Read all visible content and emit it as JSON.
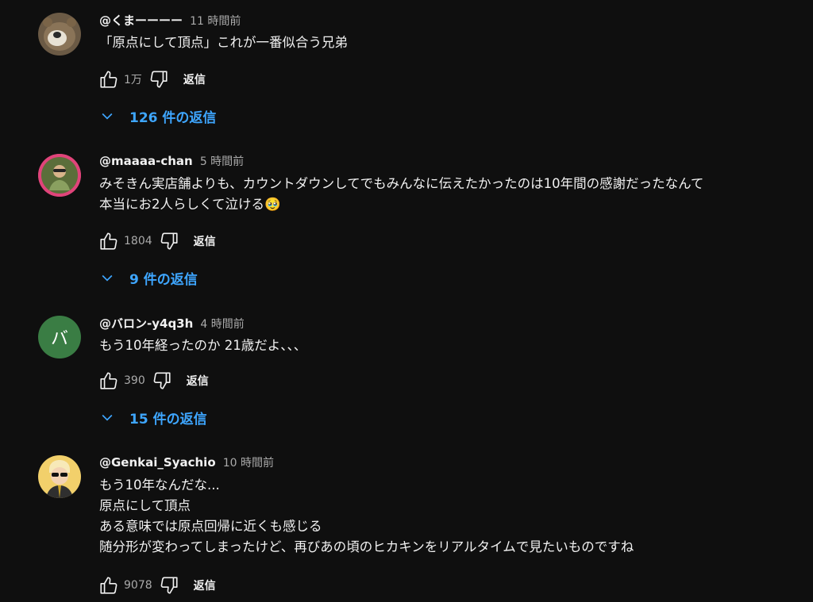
{
  "comments": [
    {
      "author": "@くまーーーー",
      "time": "11 時間前",
      "lines": [
        "「原点にして頂点」これが一番似合う兄弟"
      ],
      "likes": "1万",
      "reply_label": "返信",
      "replies_label": "126 件の返信"
    },
    {
      "author": "@maaaa-chan",
      "time": "5 時間前",
      "lines": [
        "みそきん実店舗よりも、カウントダウンしてでもみんなに伝えたかったのは10年間の感謝だったなんて",
        "本当にお2人らしくて泣ける🥹"
      ],
      "likes": "1804",
      "reply_label": "返信",
      "replies_label": "9 件の返信"
    },
    {
      "author": "@バロン-y4q3h",
      "time": "4 時間前",
      "avatar_letter": "バ",
      "lines": [
        "もう10年経ったのか 21歳だよ、、、"
      ],
      "likes": "390",
      "reply_label": "返信",
      "replies_label": "15 件の返信"
    },
    {
      "author": "@Genkai_Syachio",
      "time": "10 時間前",
      "lines": [
        "もう10年なんだな...",
        "原点にして頂点",
        "ある意味では原点回帰に近くも感じる",
        "随分形が変わってしまったけど、再びあの頃のヒカキンをリアルタイムで見たいものですね"
      ],
      "likes": "9078",
      "reply_label": "返信"
    }
  ],
  "colors": {
    "background": "#0f0f0f",
    "link": "#3ea6ff",
    "avatar_green": "#3a7d44",
    "avatar_ring": "#e0447a"
  }
}
